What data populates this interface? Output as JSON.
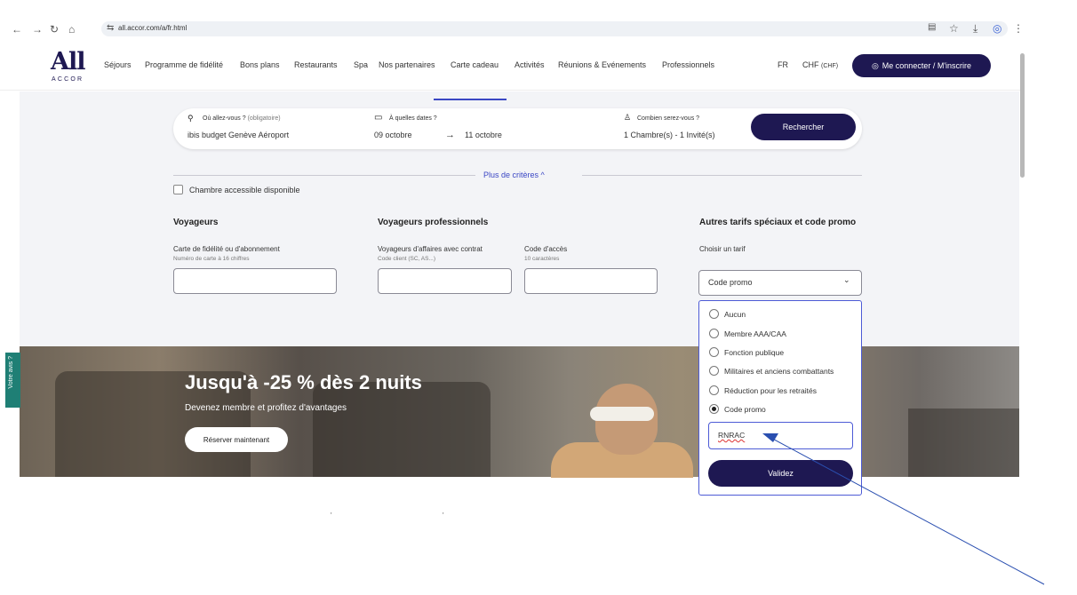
{
  "browser": {
    "url": "all.accor.com/a/fr.html",
    "icons": [
      "back-icon",
      "forward-icon",
      "reload-icon",
      "home-icon",
      "translate-icon",
      "star-icon",
      "download-icon",
      "profile-icon",
      "menu-icon"
    ]
  },
  "nav": {
    "logo_main": "All",
    "logo_sub": "ACCOR",
    "items": [
      "Séjours",
      "Programme de fidélité",
      "Bons plans",
      "Restaurants",
      "Spa",
      "Nos partenaires",
      "Carte cadeau",
      "Activités",
      "Réunions & Evénements",
      "Professionnels"
    ],
    "lang": "FR",
    "currency": "CHF",
    "currency_code": "(CHF)",
    "login": "Me connecter / M'inscrire"
  },
  "search": {
    "where_label": "Où allez-vous ?",
    "where_required": "(obligatoire)",
    "where_value": "ibis budget Genève Aéroport",
    "dates_label": "À quelles dates ?",
    "date_from": "09 octobre",
    "date_arrow": "→",
    "date_to": "11 octobre",
    "guests_label": "Combien serez-vous ?",
    "guests_value": "1 Chambre(s) - 1 Invité(s)",
    "button": "Rechercher"
  },
  "criteria": {
    "more_label": "Plus de critères ^",
    "accessible_room": "Chambre accessible disponible",
    "voyageurs": {
      "title": "Voyageurs",
      "field_label": "Carte de fidélité ou d'abonnement",
      "field_hint": "Numéro de carte à 16 chiffres"
    },
    "business": {
      "title": "Voyageurs professionnels",
      "contract_label": "Voyageurs d'affaires avec contrat",
      "contract_hint": "Code client (SC, AS...)",
      "access_label": "Code d'accès",
      "access_hint": "10 caractères"
    },
    "special": {
      "title": "Autres tarifs spéciaux et code promo",
      "choose_label": "Choisir un tarif",
      "selected": "Code promo"
    }
  },
  "dropdown": {
    "options": [
      "Aucun",
      "Membre AAA/CAA",
      "Fonction publique",
      "Militaires et anciens combattants",
      "Réduction pour les retraités",
      "Code promo"
    ],
    "selected_index": 5,
    "promo_code": "RNRAC",
    "validate": "Validez"
  },
  "banner": {
    "title": "Jusqu'à -25 % dès 2 nuits",
    "subtitle": "Devenez membre et profitez d'avantages",
    "button": "Réserver maintenant"
  },
  "feedback_tab": "Votre avis ?"
}
